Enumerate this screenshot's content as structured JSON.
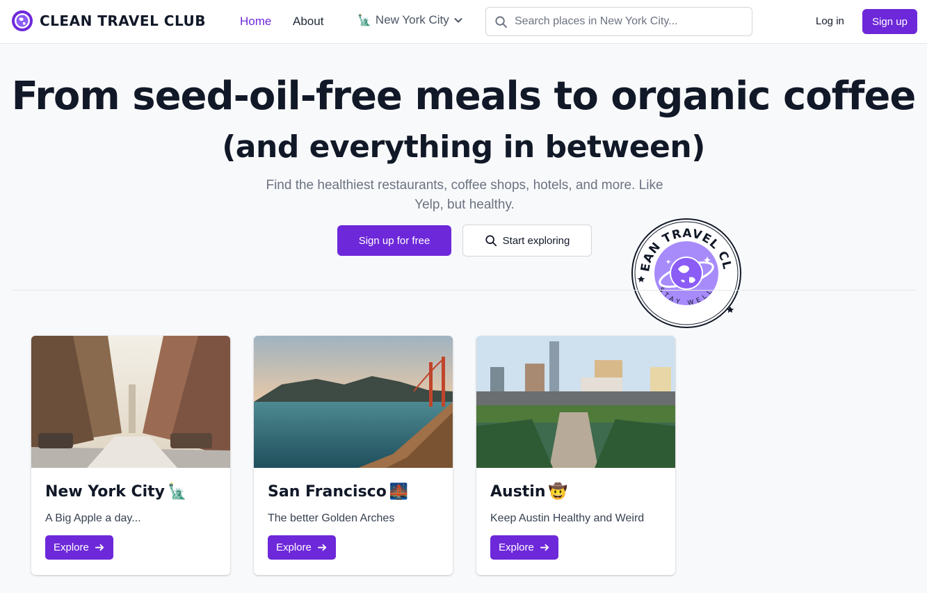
{
  "header": {
    "logo_text": "CLEAN TRAVEL CLUB",
    "nav": {
      "home": "Home",
      "about": "About"
    },
    "city_selector": {
      "emoji": "🗽",
      "label": "New York City"
    },
    "search": {
      "placeholder": "Search places in New York City..."
    },
    "login_label": "Log in",
    "signup_label": "Sign up"
  },
  "hero": {
    "title": "From seed-oil-free meals to organic coffee",
    "subtitle": "(and everything in between)",
    "description": "Find the healthiest restaurants, coffee shops, hotels, and more. Like Yelp, but healthy.",
    "primary_cta": "Sign up for free",
    "secondary_cta": "Start exploring"
  },
  "badge": {
    "top_text": "CLEAN TRAVEL CLUB",
    "bottom_text": "STAY WELL"
  },
  "cities": [
    {
      "name": "New York City",
      "emoji": "🗽",
      "tagline": "A Big Apple a day...",
      "button": "Explore"
    },
    {
      "name": "San Francisco",
      "emoji": "🌉",
      "tagline": "The better Golden Arches",
      "button": "Explore"
    },
    {
      "name": "Austin",
      "emoji": "🤠",
      "tagline": "Keep Austin Healthy and Weird",
      "button": "Explore"
    }
  ],
  "colors": {
    "accent": "#6d28d9",
    "badge_fill": "#a78bfa",
    "text_primary": "#111827",
    "text_muted": "#6b7280"
  },
  "icons": {
    "logo": "globe-icon",
    "search": "search-icon",
    "chevron": "chevron-down-icon",
    "arrow": "arrow-right-icon"
  }
}
